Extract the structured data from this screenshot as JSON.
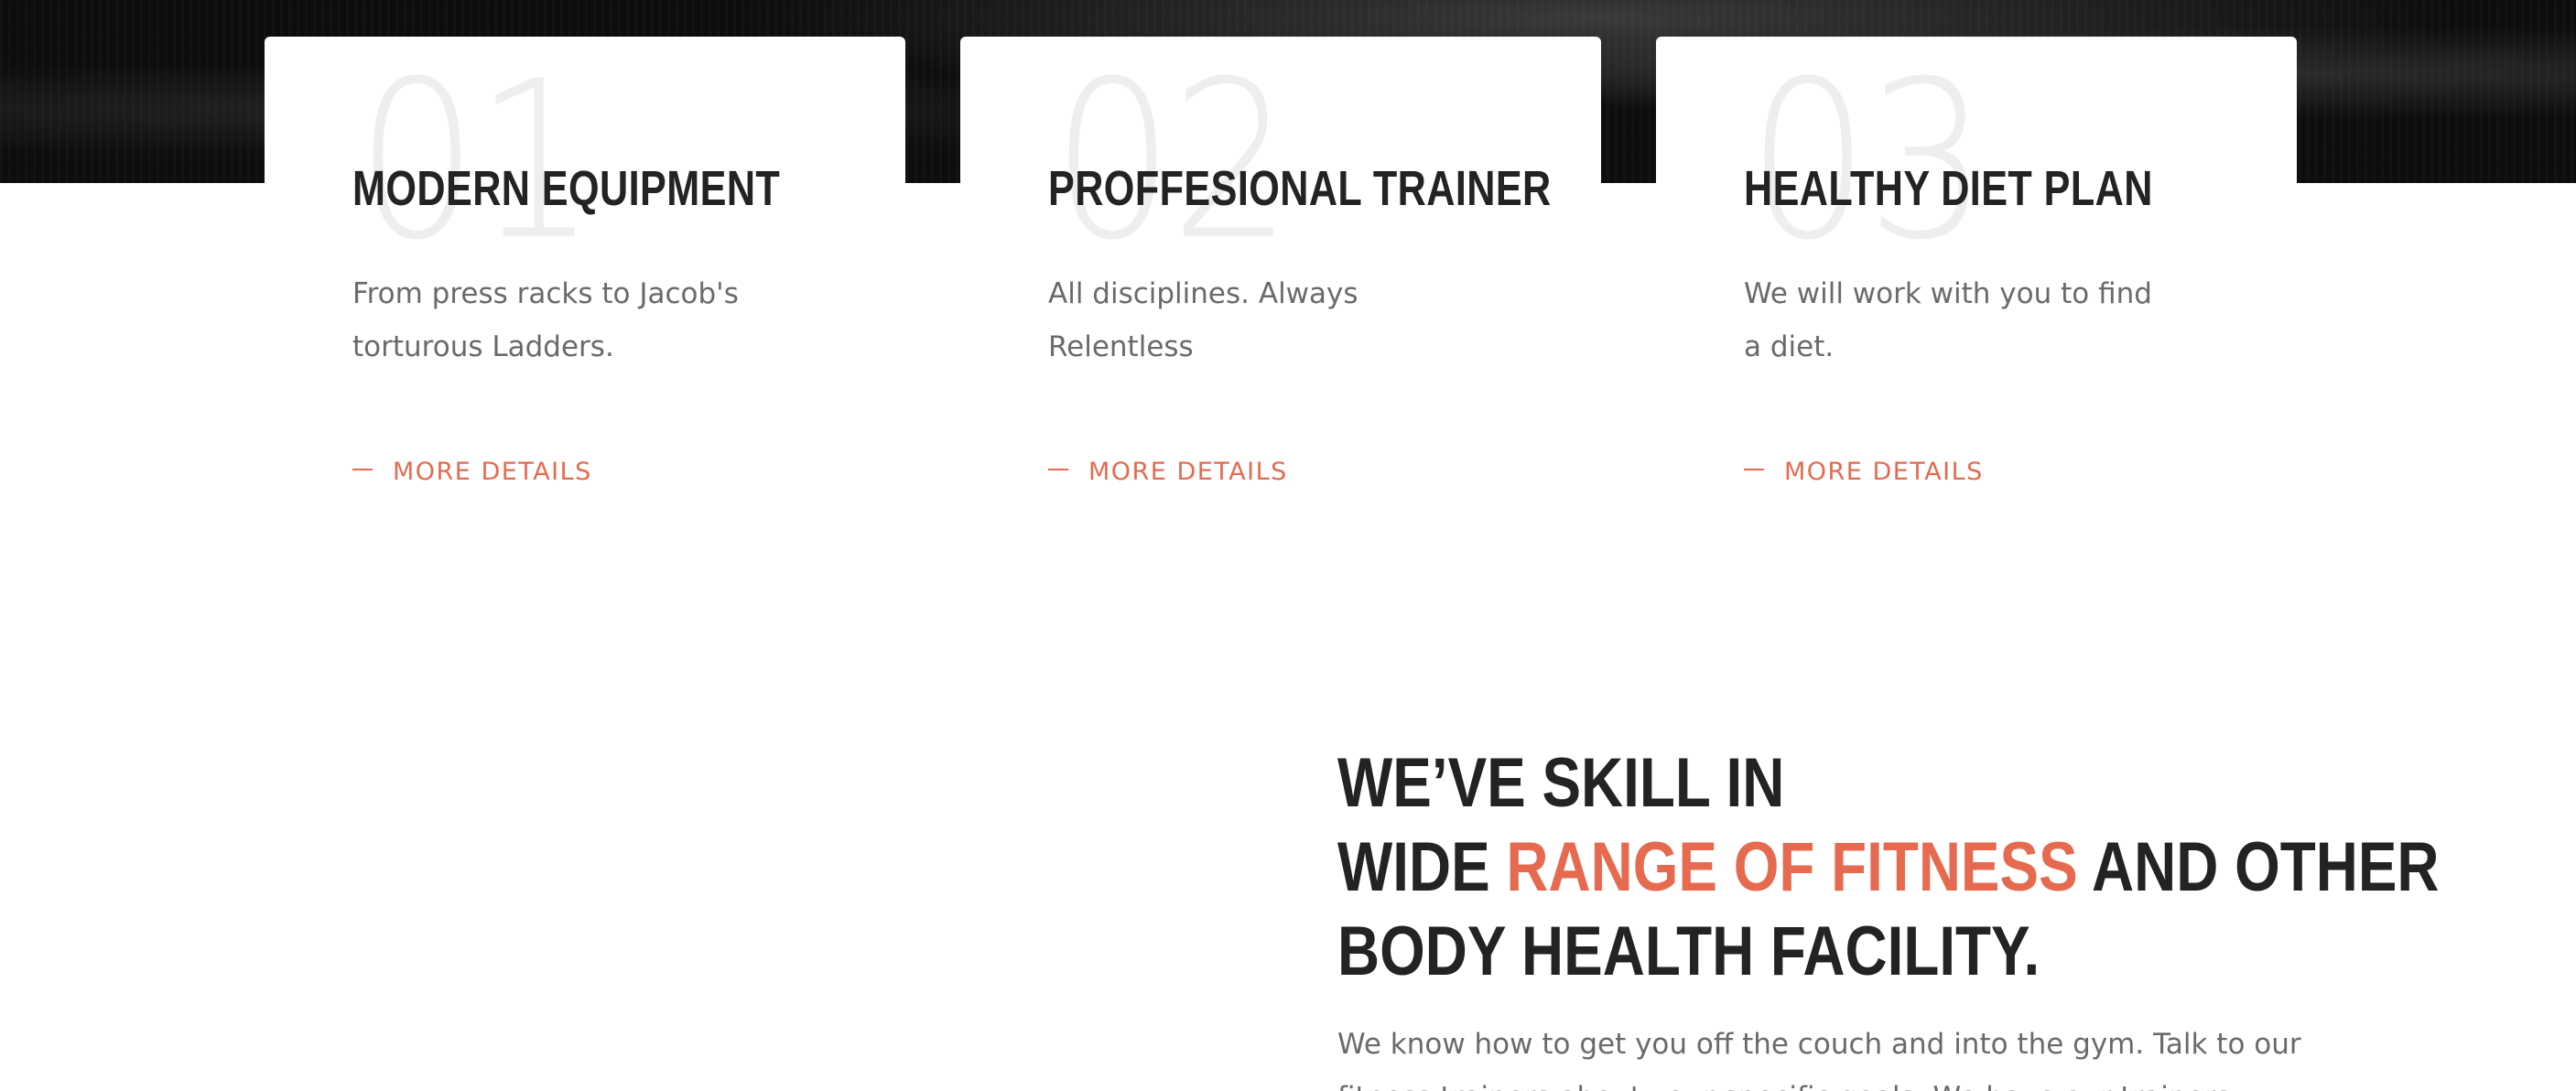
{
  "features": [
    {
      "number": "01",
      "title": "MODERN EQUIPMENT",
      "text": "From press racks to Jacob's torturous Ladders.",
      "link_label": "MORE DETAILS"
    },
    {
      "number": "02",
      "title": "PROFFESIONAL TRAINER",
      "text": "All disciplines. Always Relentless",
      "link_label": "MORE DETAILS"
    },
    {
      "number": "03",
      "title": "HEALTHY DIET PLAN",
      "text": "We will work with you to find a diet.",
      "link_label": "MORE DETAILS"
    }
  ],
  "skill_section": {
    "heading_line1": "WE’VE SKILL IN",
    "heading_line2_pre": "WIDE ",
    "heading_line2_accent": "RANGE OF FITNESS",
    "heading_line2_post": " AND OTHER",
    "heading_line3": "BODY HEALTH FACILITY.",
    "text": "We know how to get you off the couch and into the gym. Talk to our fitness trainers about your specific goals. We have our trainers"
  },
  "colors": {
    "accent": "#e56a4f",
    "heading": "#232323",
    "body_text": "#6a6a6a",
    "number_watermark": "#eeeeee",
    "hero_background": "#0d0d0d"
  }
}
